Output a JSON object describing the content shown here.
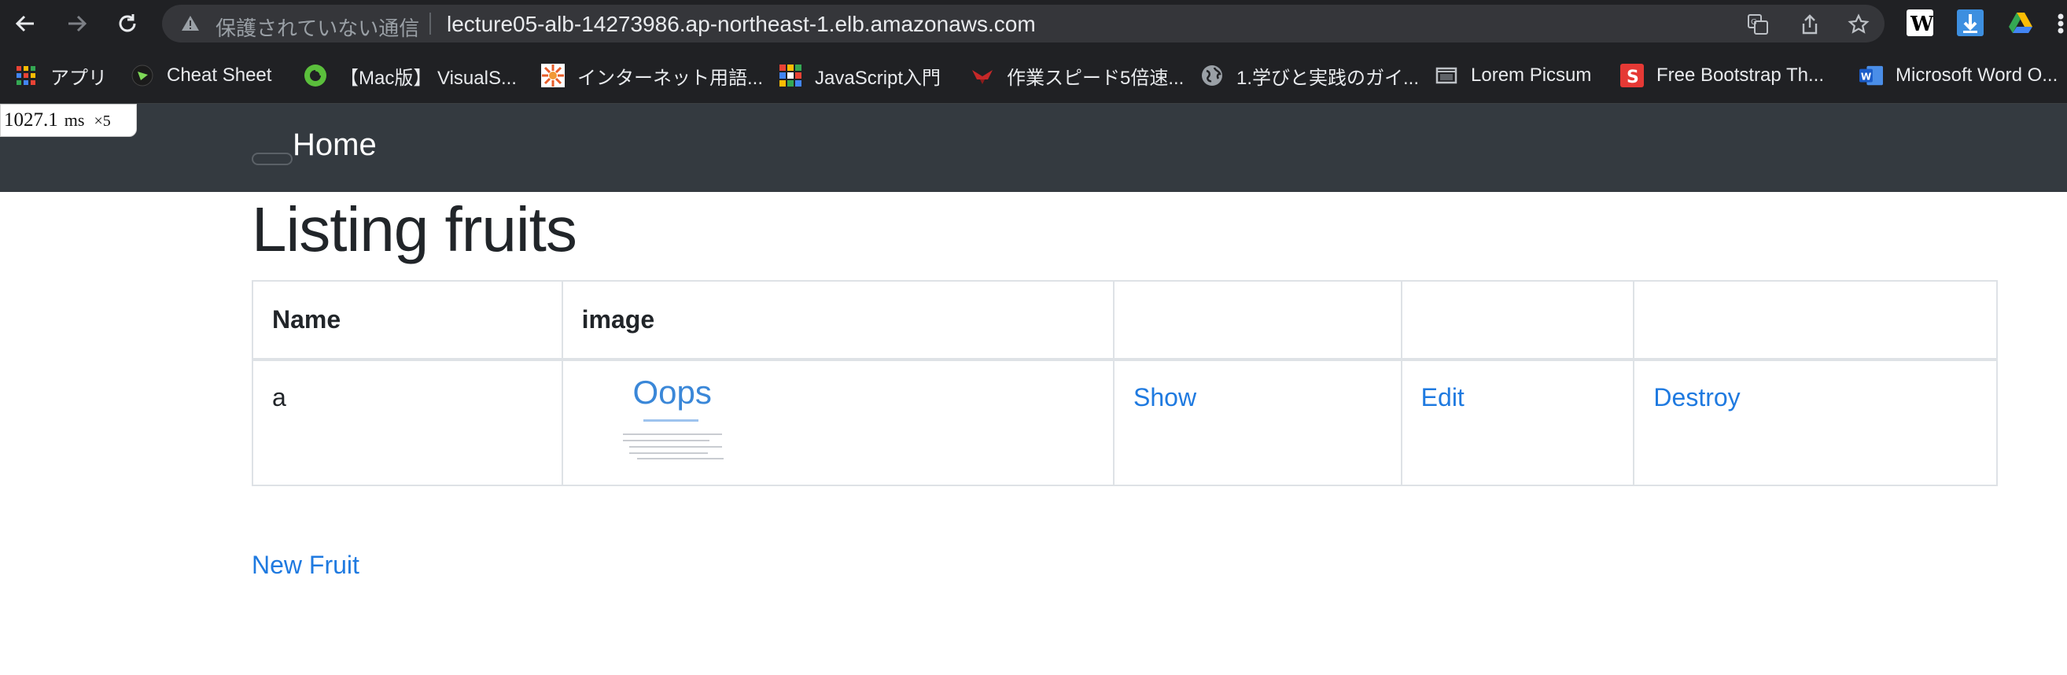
{
  "browser": {
    "security_status": "保護されていない通信",
    "url": "lecture05-alb-14273986.ap-northeast-1.elb.amazonaws.com",
    "bookmarks": [
      {
        "label": "アプリ",
        "icon": "apps-grid-icon"
      },
      {
        "label": "Cheat Sheet",
        "icon": "cheat-sheet-icon"
      },
      {
        "label": "【Mac版】 VisualS...",
        "icon": "visual-studio-icon"
      },
      {
        "label": "インターネット用語...",
        "icon": "sunburst-icon"
      },
      {
        "label": "JavaScript入門",
        "icon": "color-grid-icon"
      },
      {
        "label": "作業スピード5倍速...",
        "icon": "bird-icon"
      },
      {
        "label": "1.学びと実践のガイ...",
        "icon": "globe-icon"
      },
      {
        "label": "Lorem Picsum",
        "icon": "photo-icon"
      },
      {
        "label": "Free Bootstrap Th...",
        "icon": "s-logo-icon"
      },
      {
        "label": "Microsoft Word O...",
        "icon": "word-icon"
      }
    ]
  },
  "timer": {
    "value": "1027.1",
    "unit": "ms",
    "count": "×5"
  },
  "navbar": {
    "brand": "Home"
  },
  "page": {
    "title": "Listing fruits",
    "table": {
      "headers": [
        "Name",
        "image",
        "",
        "",
        ""
      ],
      "rows": [
        {
          "name": "a",
          "image_text": "Oops",
          "show": "Show",
          "edit": "Edit",
          "destroy": "Destroy"
        }
      ]
    },
    "new_link": "New Fruit"
  },
  "colors": {
    "navbar": "#343a40",
    "link": "#1f7ae0",
    "chrome": "#202124"
  }
}
